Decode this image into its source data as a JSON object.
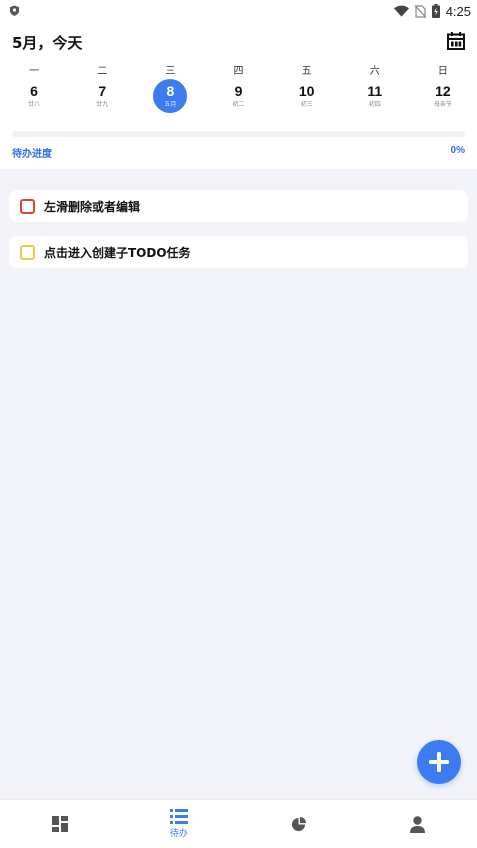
{
  "status_bar": {
    "time": "4:25",
    "icons": [
      "shield-icon",
      "wifi-icon",
      "no-sim-icon",
      "battery-charging-icon"
    ]
  },
  "header": {
    "title": "5月，今天",
    "calendar_icon": "calendar-icon"
  },
  "week": {
    "weekdays": [
      "一",
      "二",
      "三",
      "四",
      "五",
      "六",
      "日"
    ],
    "dates": [
      {
        "day": "6",
        "lunar": "廿八",
        "selected": false
      },
      {
        "day": "7",
        "lunar": "廿九",
        "selected": false
      },
      {
        "day": "8",
        "lunar": "五月",
        "selected": true
      },
      {
        "day": "9",
        "lunar": "初二",
        "selected": false
      },
      {
        "day": "10",
        "lunar": "初三",
        "selected": false
      },
      {
        "day": "11",
        "lunar": "初四",
        "selected": false
      },
      {
        "day": "12",
        "lunar": "母亲节",
        "selected": false
      }
    ]
  },
  "progress": {
    "label": "待办进度",
    "value_text": "0%",
    "value": 0
  },
  "todos": [
    {
      "text": "左滑删除或者编辑",
      "color": "#d64a3b"
    },
    {
      "text": "点击进入创建子TODO任务",
      "color": "#f2c94c"
    }
  ],
  "fab": {
    "icon": "plus-icon"
  },
  "bottom_nav": {
    "items": [
      {
        "icon": "dashboard-icon",
        "label": "",
        "active": false
      },
      {
        "icon": "list-icon",
        "label": "待办",
        "active": true
      },
      {
        "icon": "pie-chart-icon",
        "label": "",
        "active": false
      },
      {
        "icon": "person-icon",
        "label": "",
        "active": false
      }
    ]
  },
  "colors": {
    "accent": "#3b7cf0",
    "background": "#f3f4f9",
    "card": "#ffffff"
  }
}
